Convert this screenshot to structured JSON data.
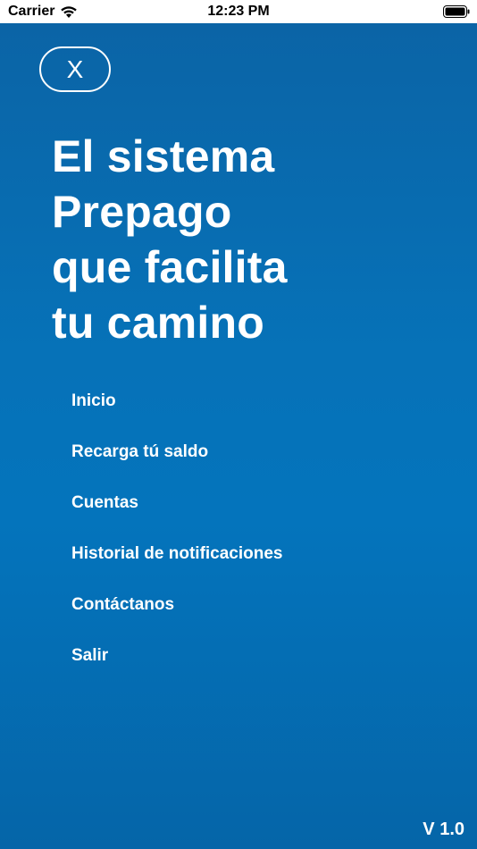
{
  "status_bar": {
    "carrier": "Carrier",
    "time": "12:23 PM",
    "wifi_icon": "wifi-icon",
    "battery_icon": "battery-icon"
  },
  "menu_screen": {
    "close_label": "X",
    "headline_lines": [
      "El sistema",
      "Prepago",
      "que facilita",
      "tu camino"
    ],
    "items": [
      {
        "label": "Inicio"
      },
      {
        "label": "Recarga tú saldo"
      },
      {
        "label": "Cuentas"
      },
      {
        "label": "Historial de notificaciones"
      },
      {
        "label": "Contáctanos"
      },
      {
        "label": "Salir"
      }
    ],
    "version": "V 1.0"
  },
  "colors": {
    "panel_background": "#0672b8",
    "text": "#ffffff",
    "status_bar_background": "#ffffff"
  }
}
